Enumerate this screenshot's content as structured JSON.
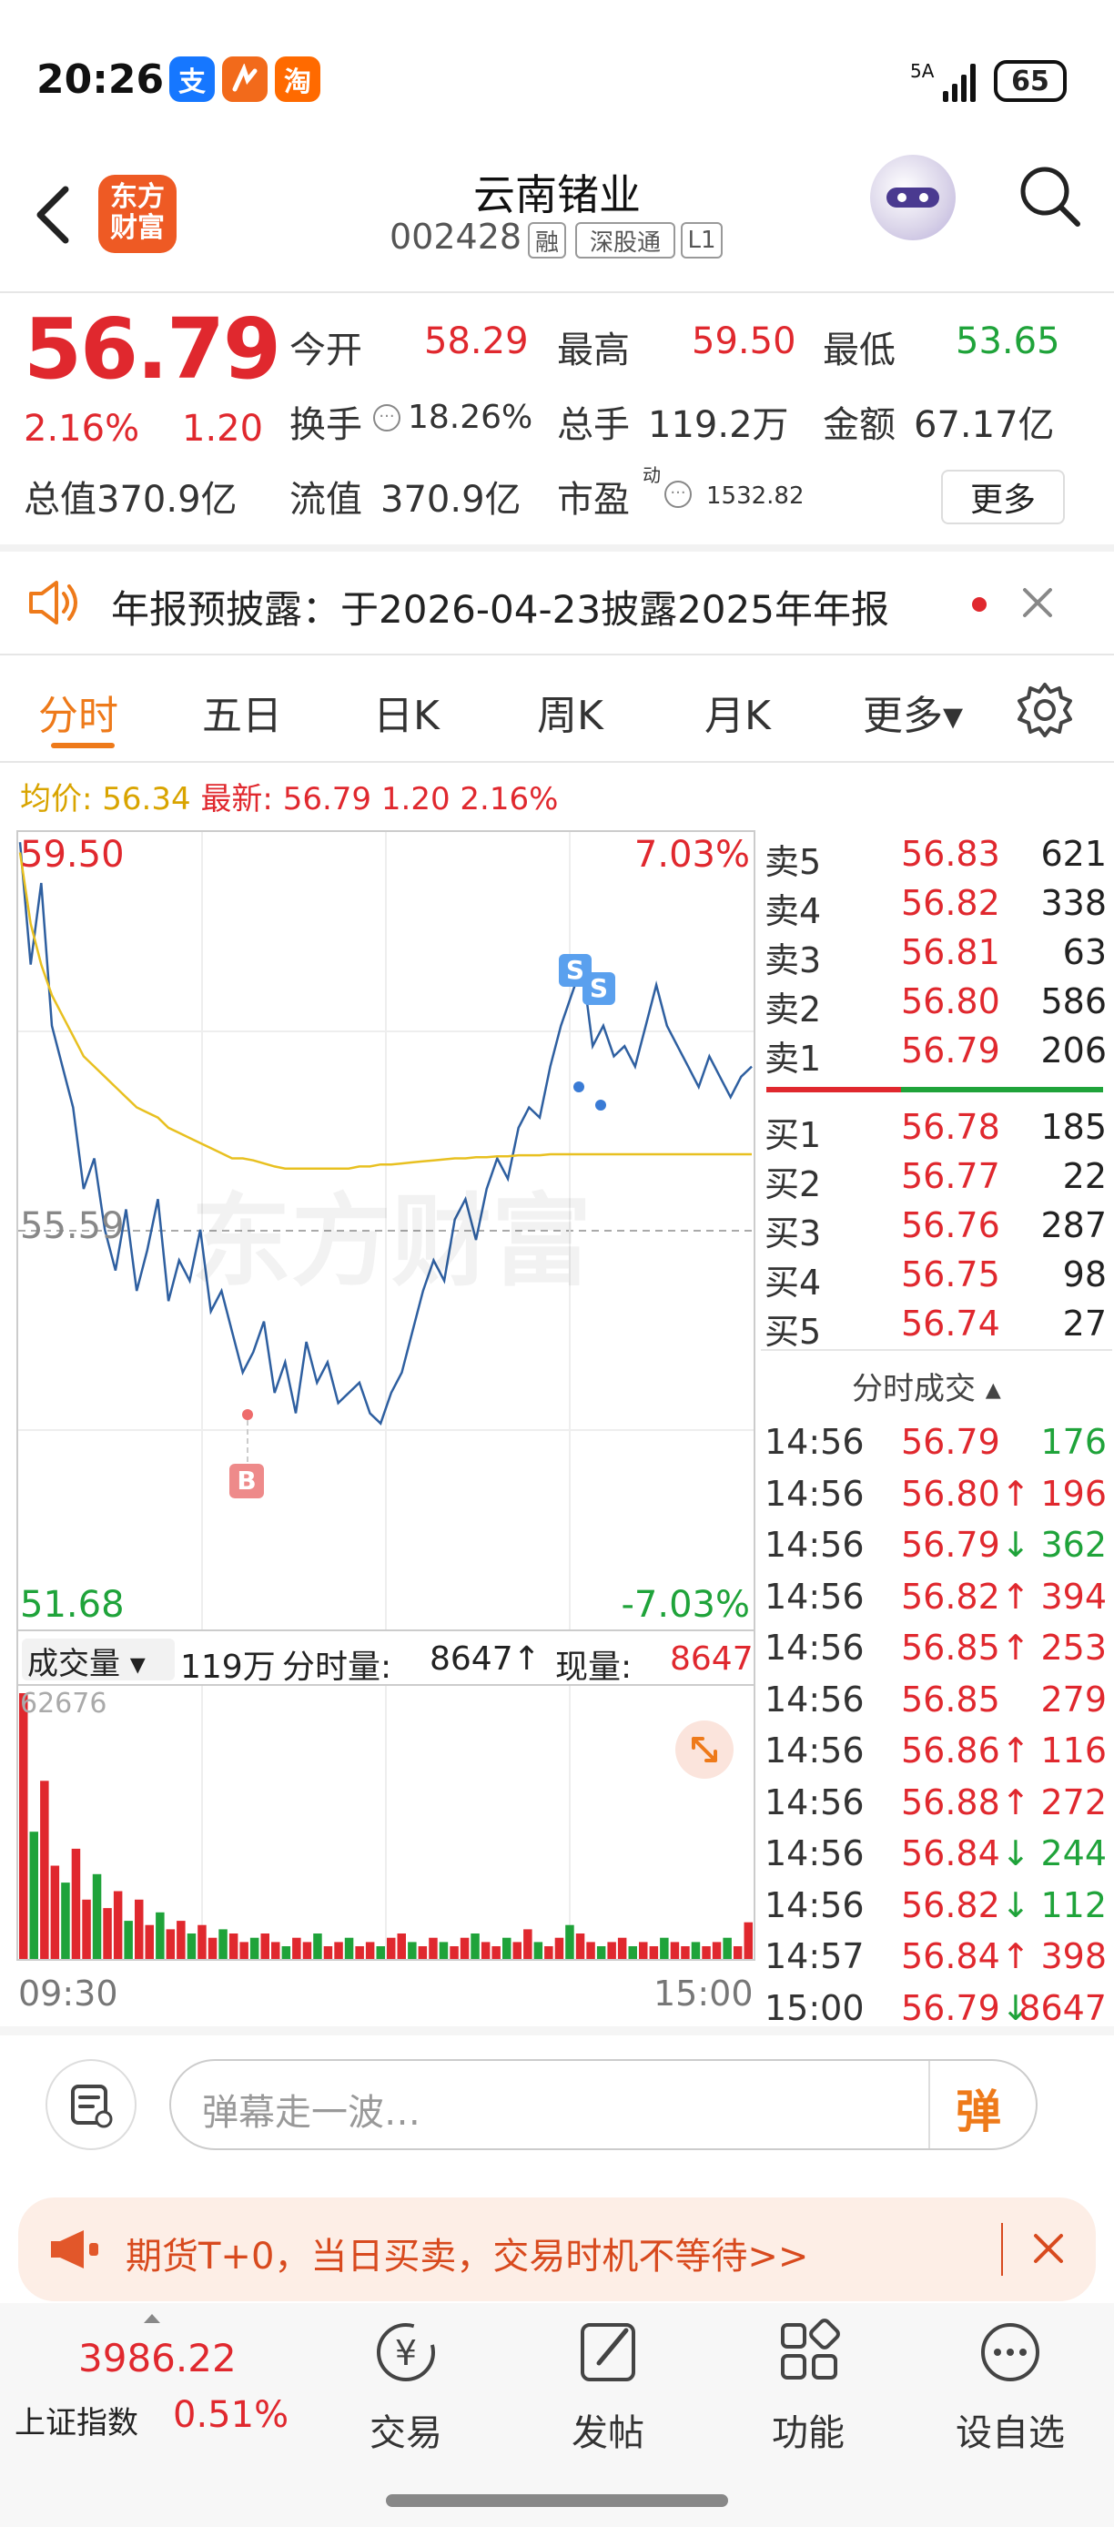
{
  "status_bar": {
    "time": "20:26",
    "app_badges": [
      "支",
      "",
      "淘"
    ],
    "signal_label": "5A",
    "battery": "65"
  },
  "header": {
    "logo_text_1": "东方",
    "logo_text_2": "财富",
    "stock_name": "云南锗业",
    "stock_code": "002428",
    "tags": [
      "融",
      "深股通",
      "L1"
    ]
  },
  "quote": {
    "price": "56.79",
    "change_pct": "2.16%",
    "change": "1.20",
    "open_label": "今开",
    "open": "58.29",
    "high_label": "最高",
    "high": "59.50",
    "low_label": "最低",
    "low": "53.65",
    "turnover_label": "换手",
    "turnover": "18.26%",
    "volume_label": "总手",
    "volume": "119.2万",
    "amount_label": "金额",
    "amount": "67.17亿",
    "mktcap_label": "总值",
    "mktcap": "370.9亿",
    "float_label": "流值",
    "float": "370.9亿",
    "pe_label": "市盈",
    "pe_sup": "动",
    "pe": "1532.82",
    "more_button": "更多"
  },
  "notice": {
    "text": "年报预披露：于2026-04-23披露2025年年报"
  },
  "tabs": [
    "分时",
    "五日",
    "日K",
    "周K",
    "月K",
    "更多▾"
  ],
  "info_row": {
    "avg_label": "均价:",
    "avg": "56.34",
    "latest_label": "最新:",
    "latest": "56.79",
    "latest_change": "1.20",
    "latest_pct": "2.16%"
  },
  "chart_labels": {
    "top_price": "59.50",
    "top_pct": "7.03%",
    "mid_price": "55.59",
    "bottom_price": "51.68",
    "bottom_pct": "-7.03%",
    "watermark": "东方财富",
    "marker_b": "B",
    "marker_s": "S",
    "vol_selector": "成交量 ▾",
    "vol_total": "119万",
    "vol_minute_label": "分时量:",
    "vol_minute": "8647↑",
    "vol_now_label": "现量:",
    "vol_now": "8647",
    "vol_max": "62676",
    "time_start": "09:30",
    "time_end": "15:00"
  },
  "chart_data": {
    "type": "line",
    "title": "",
    "ylim": [
      51.68,
      59.5
    ],
    "x_range": [
      "09:30",
      "15:00"
    ],
    "series": [
      {
        "name": "",
        "values": [
          59.4,
          58.2,
          59.0,
          57.6,
          57.2,
          56.8,
          56.0,
          56.3,
          55.6,
          55.2,
          55.8,
          55.0,
          55.4,
          55.9,
          54.9,
          55.3,
          55.1,
          55.6,
          54.8,
          55.0,
          54.6,
          54.2,
          54.4,
          54.7,
          54.0,
          54.3,
          53.8,
          54.5,
          54.1,
          54.3,
          53.9,
          54.0,
          54.1,
          53.8,
          53.7,
          54.0,
          54.2,
          54.6,
          55.0,
          55.3,
          55.1,
          55.7,
          55.9,
          55.5,
          56.0,
          56.3,
          56.1,
          56.6,
          56.8,
          56.7,
          57.2,
          57.6,
          57.9,
          58.2,
          57.4,
          57.6,
          57.3,
          57.4,
          57.2,
          57.6,
          58.0,
          57.6,
          57.4,
          57.2,
          57.0,
          57.3,
          57.1,
          56.9,
          57.1,
          57.2
        ]
      },
      {
        "name": "",
        "values": [
          59.3,
          58.6,
          58.2,
          57.9,
          57.7,
          57.5,
          57.3,
          57.2,
          57.1,
          57.0,
          56.9,
          56.8,
          56.75,
          56.7,
          56.6,
          56.55,
          56.5,
          56.45,
          56.4,
          56.35,
          56.3,
          56.3,
          56.28,
          56.25,
          56.22,
          56.2,
          56.2,
          56.2,
          56.2,
          56.2,
          56.2,
          56.2,
          56.22,
          56.22,
          56.24,
          56.24,
          56.25,
          56.26,
          56.27,
          56.28,
          56.29,
          56.3,
          56.3,
          56.31,
          56.31,
          56.32,
          56.32,
          56.33,
          56.33,
          56.33,
          56.34,
          56.34,
          56.34,
          56.34,
          56.34,
          56.34,
          56.34,
          56.34,
          56.34,
          56.34,
          56.34,
          56.34,
          56.34,
          56.34,
          56.34,
          56.34,
          56.34,
          56.34,
          56.34,
          56.34
        ]
      }
    ],
    "volume": [
      62676,
      30000,
      42000,
      22000,
      18000,
      26000,
      14000,
      20000,
      12000,
      16000,
      9000,
      14000,
      8000,
      11000,
      7000,
      9000,
      6000,
      8000,
      5000,
      7000,
      6000,
      4000,
      5000,
      6000,
      4000,
      3000,
      5000,
      4000,
      6000,
      3000,
      4000,
      5000,
      3000,
      4000,
      3000,
      5000,
      6000,
      4000,
      3000,
      5000,
      4000,
      3000,
      5000,
      6000,
      4000,
      3000,
      5000,
      4000,
      7000,
      4000,
      3000,
      5000,
      8000,
      6000,
      4000,
      3000,
      4000,
      5000,
      3000,
      4000,
      3000,
      5000,
      4000,
      3000,
      4000,
      3000,
      4000,
      5000,
      3000,
      8647
    ]
  },
  "order_book": {
    "asks": [
      {
        "label": "卖5",
        "price": "56.83",
        "vol": "621"
      },
      {
        "label": "卖4",
        "price": "56.82",
        "vol": "338"
      },
      {
        "label": "卖3",
        "price": "56.81",
        "vol": "63"
      },
      {
        "label": "卖2",
        "price": "56.80",
        "vol": "586"
      },
      {
        "label": "卖1",
        "price": "56.79",
        "vol": "206"
      }
    ],
    "bids": [
      {
        "label": "买1",
        "price": "56.78",
        "vol": "185"
      },
      {
        "label": "买2",
        "price": "56.77",
        "vol": "22"
      },
      {
        "label": "买3",
        "price": "56.76",
        "vol": "287"
      },
      {
        "label": "买4",
        "price": "56.75",
        "vol": "98"
      },
      {
        "label": "买5",
        "price": "56.74",
        "vol": "27"
      }
    ],
    "ticks_header": "分时成交 ▴",
    "ticks": [
      {
        "time": "14:56",
        "price": "56.79",
        "vol": "176",
        "dir": "",
        "color": "green"
      },
      {
        "time": "14:56",
        "price": "56.80",
        "vol": "196",
        "dir": "↑",
        "color": "red"
      },
      {
        "time": "14:56",
        "price": "56.79",
        "vol": "362",
        "dir": "↓",
        "color": "green"
      },
      {
        "time": "14:56",
        "price": "56.82",
        "vol": "394",
        "dir": "↑",
        "color": "red"
      },
      {
        "time": "14:56",
        "price": "56.85",
        "vol": "253",
        "dir": "↑",
        "color": "red"
      },
      {
        "time": "14:56",
        "price": "56.85",
        "vol": "279",
        "dir": "",
        "color": "red"
      },
      {
        "time": "14:56",
        "price": "56.86",
        "vol": "116",
        "dir": "↑",
        "color": "red"
      },
      {
        "time": "14:56",
        "price": "56.88",
        "vol": "272",
        "dir": "↑",
        "color": "red"
      },
      {
        "time": "14:56",
        "price": "56.84",
        "vol": "244",
        "dir": "↓",
        "color": "green"
      },
      {
        "time": "14:56",
        "price": "56.82",
        "vol": "112",
        "dir": "↓",
        "color": "green"
      },
      {
        "time": "14:57",
        "price": "56.84",
        "vol": "398",
        "dir": "↑",
        "color": "red"
      },
      {
        "time": "15:00",
        "price": "56.79",
        "vol": "8647",
        "dir": "↓",
        "color": "red"
      }
    ]
  },
  "danmu": {
    "placeholder": "弹幕走一波…",
    "send_label": "弹"
  },
  "promo": {
    "text": "期货T+0，当日买卖，交易时机不等待>>"
  },
  "navbar": {
    "index_value": "3986.22",
    "index_name": "上证指数",
    "index_pct": "0.51%",
    "items": [
      "交易",
      "发帖",
      "功能",
      "设自选"
    ]
  },
  "colors": {
    "up": "#e0282e",
    "down": "#1fa33a",
    "accent": "#ee7a1a",
    "avg_line": "#e8c020",
    "price_line": "#2e5fa0"
  }
}
